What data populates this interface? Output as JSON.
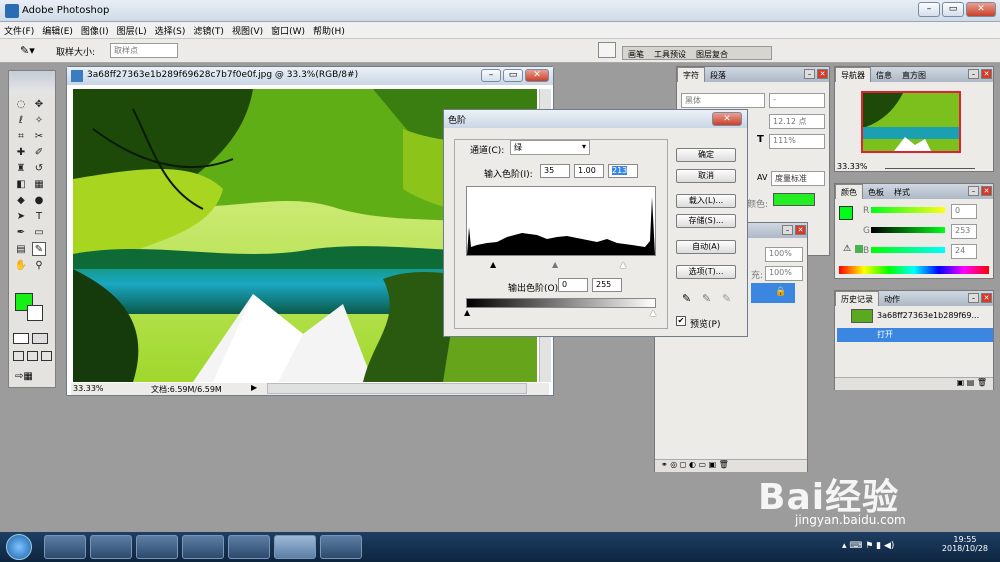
{
  "app": {
    "title": "Adobe Photoshop"
  },
  "window_controls": {
    "minimize": "–",
    "restore": "▭",
    "close": "✕"
  },
  "menu": [
    "文件(F)",
    "编辑(E)",
    "图像(I)",
    "图层(L)",
    "选择(S)",
    "滤镜(T)",
    "视图(V)",
    "窗口(W)",
    "帮助(H)"
  ],
  "options": {
    "sample_label": "取样大小:",
    "sample_value": "取样点"
  },
  "dock_tabs": [
    "画笔",
    "工具预设",
    "图层复合"
  ],
  "document": {
    "title": "3a68ff27363e1b289f69628c7b7f0e0f.jpg @ 33.3%(RGB/8#)",
    "zoom": "33.33%",
    "doc_info": "文档:6.59M/6.59M"
  },
  "levels": {
    "title": "色阶",
    "channel_label": "通道(C):",
    "channel_value": "绿",
    "input_label": "输入色阶(I):",
    "input_black": "35",
    "input_gamma": "1.00",
    "input_white": "213",
    "output_label": "输出色阶(O):",
    "output_black": "0",
    "output_white": "255",
    "buttons": {
      "ok": "确定",
      "cancel": "取消",
      "load": "载入(L)...",
      "save": "存储(S)...",
      "auto": "自动(A)",
      "options": "选项(T)..."
    },
    "preview_label": "预览(P)",
    "preview_checked": true
  },
  "char_panel": {
    "tabs": [
      "字符",
      "段落"
    ],
    "font": "黑体",
    "font_style": "-",
    "size": "12.12 点",
    "leading": "111%",
    "tracking": "度量标准",
    "color_label": "颜色:",
    "color": "#22ee22"
  },
  "layers_panel": {
    "fill1": "100%",
    "fill2": "100%",
    "label2": "充:"
  },
  "navigator": {
    "tabs": [
      "导航器",
      "信息",
      "直方图"
    ],
    "zoom": "33.33%"
  },
  "color_panel": {
    "tabs": [
      "颜色",
      "色板",
      "样式"
    ],
    "r": "0",
    "g": "253",
    "b": "24",
    "labels": {
      "r": "R",
      "g": "G",
      "b": "B"
    },
    "fg": "#00fd18"
  },
  "history_panel": {
    "tabs": [
      "历史记录",
      "动作"
    ],
    "snapshot": "3a68ff27363e1b289f69...",
    "step": "打开"
  },
  "taskbar": {
    "time": "19:55",
    "date": "2018/10/28"
  },
  "watermark": {
    "text": "Bai经验",
    "url": "jingyan.baidu.com"
  }
}
